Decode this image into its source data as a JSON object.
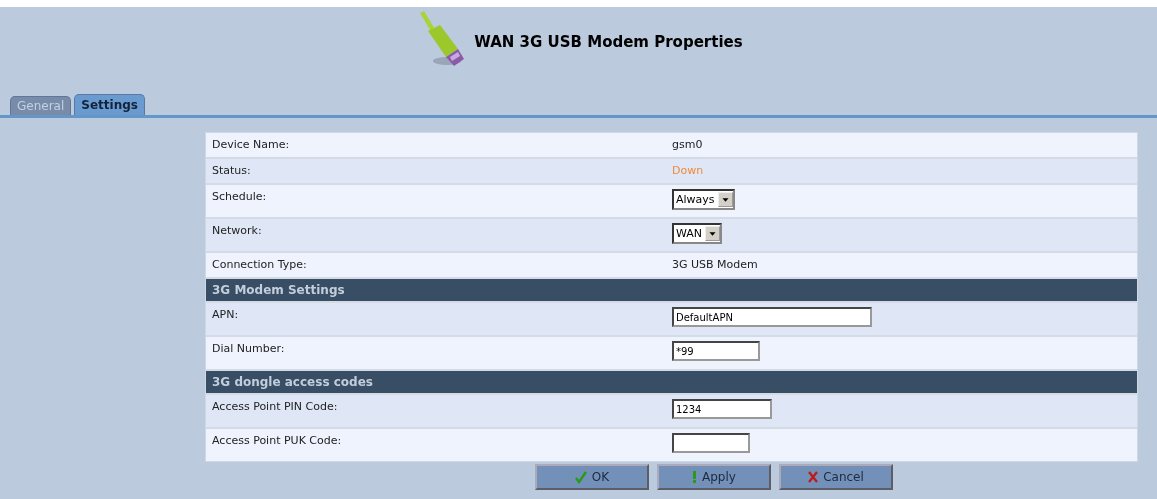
{
  "title": "WAN 3G USB Modem Properties",
  "tabs": [
    {
      "label": "General",
      "selected": false
    },
    {
      "label": "Settings",
      "selected": true
    }
  ],
  "rows": [
    {
      "kind": "text",
      "label": "Device Name:",
      "value": "gsm0"
    },
    {
      "kind": "status",
      "label": "Status:",
      "value": "Down"
    },
    {
      "kind": "select",
      "label": "Schedule:",
      "value": "Always"
    },
    {
      "kind": "select",
      "label": "Network:",
      "value": "WAN"
    },
    {
      "kind": "text",
      "label": "Connection Type:",
      "value": "3G USB Modem"
    },
    {
      "kind": "section",
      "label": "3G Modem Settings"
    },
    {
      "kind": "input",
      "label": "APN:",
      "value": "DefaultAPN"
    },
    {
      "kind": "input",
      "label": "Dial Number:",
      "value": "*99"
    },
    {
      "kind": "section",
      "label": "3G dongle access codes"
    },
    {
      "kind": "input",
      "label": "Access Point PIN Code:",
      "value": "1234"
    },
    {
      "kind": "input",
      "label": "Access Point PUK Code:"
    }
  ],
  "buttons": [
    {
      "kind": "ok",
      "label": "OK"
    },
    {
      "kind": "apply",
      "label": "Apply"
    },
    {
      "kind": "cancel",
      "label": "Cancel"
    }
  ]
}
